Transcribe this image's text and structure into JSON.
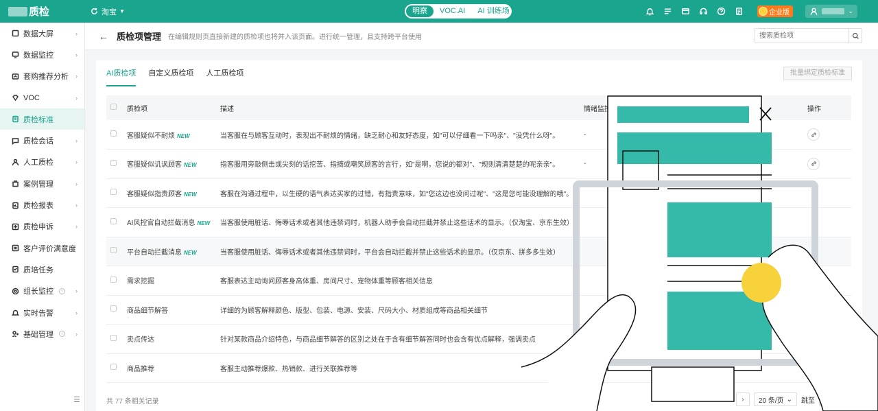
{
  "topbar": {
    "app_name": "质检",
    "shop": "淘宝",
    "segments": [
      "明察",
      "VOC.AI",
      "AI 训练场"
    ],
    "enterprise_badge": "企业版",
    "icons": [
      "bell-icon",
      "list-icon",
      "window-icon",
      "headset-icon",
      "help-icon",
      "document-icon"
    ]
  },
  "sidebar": {
    "items": [
      {
        "label": "数据大屏",
        "icon": "dashboard-icon",
        "chevron": true
      },
      {
        "label": "数据监控",
        "icon": "monitor-icon",
        "chevron": true
      },
      {
        "label": "套购推荐分析",
        "icon": "analysis-icon",
        "chevron": true
      },
      {
        "label": "VOC",
        "icon": "diamond-icon",
        "chevron": true
      },
      {
        "label": "质检标准",
        "icon": "document-icon",
        "chevron": false
      },
      {
        "label": "质检会话",
        "icon": "chat-icon",
        "chevron": true
      },
      {
        "label": "人工质检",
        "icon": "person-icon",
        "chevron": true
      },
      {
        "label": "案例管理",
        "icon": "case-icon",
        "chevron": true
      },
      {
        "label": "质检报表",
        "icon": "report-icon",
        "chevron": true
      },
      {
        "label": "质检申诉",
        "icon": "appeal-icon",
        "chevron": true
      },
      {
        "label": "客户评价满意度",
        "icon": "rating-icon",
        "chevron": false
      },
      {
        "label": "质培任务",
        "icon": "task-icon",
        "chevron": false
      },
      {
        "label": "组长监控",
        "icon": "target-icon",
        "chevron": true
      },
      {
        "label": "实时告警",
        "icon": "alarm-icon",
        "chevron": true
      },
      {
        "label": "基础管理",
        "icon": "settings-icon",
        "chevron": true
      }
    ]
  },
  "header": {
    "title": "质检项管理",
    "description": "在编辑规则页直接新建的质检项也将并入该页面。进行统一管理，且支持跨平台使用",
    "search_placeholder": "搜索质检项"
  },
  "tabs": [
    "AI质检项",
    "自定义质检项",
    "人工质检项"
  ],
  "bulk_button": "批量绑定质检标准",
  "table": {
    "columns": [
      "质检项",
      "描述",
      "情绪监控",
      "操作"
    ],
    "rows": [
      {
        "name": "客服疑似不耐烦",
        "new": "NEW",
        "desc": "当客服在与顾客互动时，表现出不耐烦的情绪，缺乏耐心和友好态度，如\"可以仔细看一下吗亲\"、\"没凭什么呀\"。",
        "emotion": "-"
      },
      {
        "name": "客服疑似讥讽顾客",
        "new": "NEW",
        "desc": "指客服用旁敲侧击或尖刻的话挖苦、指摘或嘲笑顾客的言行，如\"是啊，您说的都对\"、\"规则清清楚楚的呢亲亲\"。",
        "emotion": "-"
      },
      {
        "name": "客服疑似指责顾客",
        "new": "NEW",
        "desc": "客服在沟通过程中，以生硬的语气表达买家的过错，有指责意味，如\"您这边也没问过呢\"、\"这是您可能没理解的哦\"。",
        "emotion": ""
      },
      {
        "name": "AI风控官自动拦截消息",
        "new": "NEW",
        "desc": "当客服使用脏话、侮辱话术或者其他违禁词时，机器人助手会自动拦截并禁止这些话术的显示。（仅淘宝、京东生效）",
        "emotion": ""
      },
      {
        "name": "平台自动拦截消息",
        "new": "NEW",
        "desc": "当客服使用脏话、侮辱话术或者其他违禁词时，平台会自动拦截并禁止这些话术的显示。（仅京东、拼多多生效）",
        "emotion": ""
      },
      {
        "name": "需求挖掘",
        "new": "",
        "desc": "客服表达主动询问顾客身高体重、房间尺寸、宠物体重等顾客相关信息",
        "emotion": ""
      },
      {
        "name": "商品细节解答",
        "new": "",
        "desc": "详细的为顾客解释颜色、版型、包装、电源、安装、尺码大小、材质组成等商品相关细节",
        "emotion": ""
      },
      {
        "name": "卖点传达",
        "new": "",
        "desc": "针对某款商品介绍特色，与商品细节解答的区别之处在于含有细节解答同时也会含有优点解释，强调卖点",
        "emotion": ""
      },
      {
        "name": "商品推荐",
        "new": "",
        "desc": "客服主动推荐爆款、热销款、进行关联推荐等",
        "emotion": ""
      }
    ]
  },
  "footer": {
    "total": "共 77 条相关记录",
    "page_size": "20 条/页",
    "jump_label": "跳至",
    "page_unit": "页"
  },
  "colors": {
    "brand": "#1aa58e",
    "accent": "#ff7a1a",
    "illustration": "#35b9a8"
  }
}
